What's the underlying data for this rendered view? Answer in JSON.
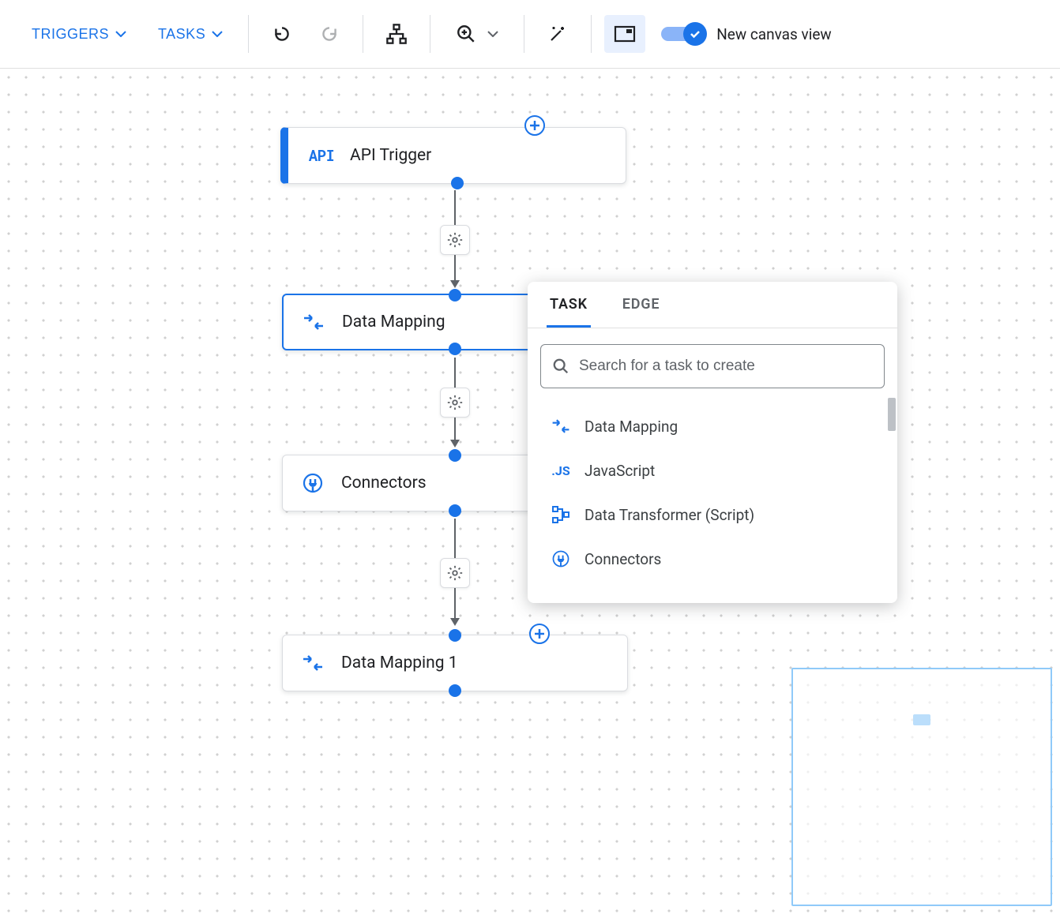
{
  "toolbar": {
    "triggers_label": "TRIGGERS",
    "tasks_label": "TASKS",
    "toggle_label": "New canvas view"
  },
  "nodes": {
    "api_trigger": {
      "label": "API Trigger",
      "icon_text": "API"
    },
    "data_mapping": {
      "label": "Data Mapping"
    },
    "connectors": {
      "label": "Connectors"
    },
    "data_mapping_1": {
      "label": "Data Mapping 1"
    }
  },
  "popup": {
    "tabs": {
      "task": "TASK",
      "edge": "EDGE"
    },
    "search_placeholder": "Search for a task to create",
    "items": {
      "data_mapping": "Data Mapping",
      "javascript_icon": ".JS",
      "javascript": "JavaScript",
      "data_transformer": "Data Transformer (Script)",
      "connectors": "Connectors"
    }
  }
}
